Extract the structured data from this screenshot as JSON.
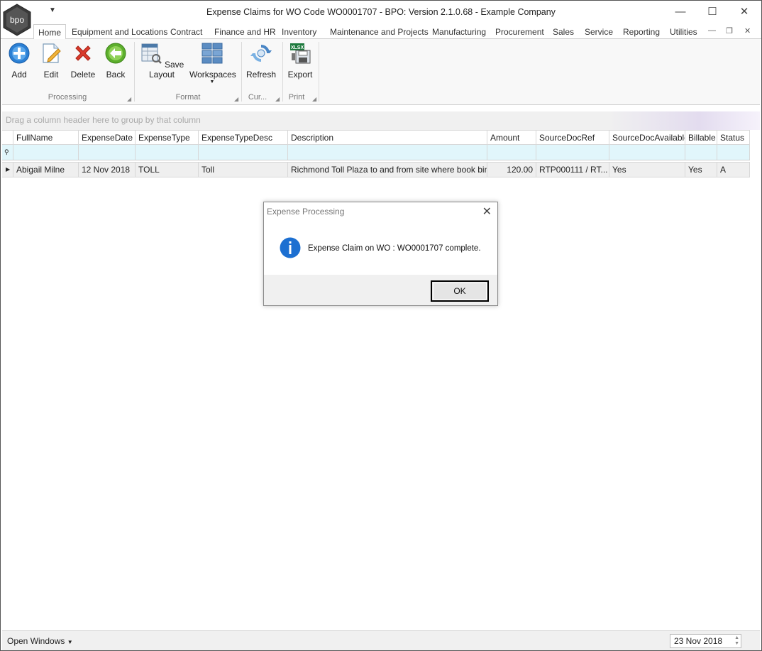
{
  "window": {
    "title": "Expense Claims for WO Code WO0001707 - BPO: Version 2.1.0.68 - Example Company",
    "logo_text": "bpo",
    "minimize_icon": "minimize-icon",
    "maximize_icon": "maximize-icon",
    "close_icon": "close-icon"
  },
  "tabs": [
    {
      "label": "Home",
      "active": true
    },
    {
      "label": "Equipment and Locations"
    },
    {
      "label": "Contract"
    },
    {
      "label": "Finance and HR"
    },
    {
      "label": "Inventory"
    },
    {
      "label": "Maintenance and Projects"
    },
    {
      "label": "Manufacturing"
    },
    {
      "label": "Procurement"
    },
    {
      "label": "Sales"
    },
    {
      "label": "Service"
    },
    {
      "label": "Reporting"
    },
    {
      "label": "Utilities"
    }
  ],
  "ribbon": {
    "add": "Add",
    "edit": "Edit",
    "delete": "Delete",
    "back": "Back",
    "save_layout": "Save Layout",
    "workspaces": "Workspaces",
    "refresh": "Refresh",
    "export": "Export",
    "export_badge": "XLSX",
    "groups": {
      "processing": "Processing",
      "format": "Format",
      "current": "Cur...",
      "print": "Print"
    }
  },
  "grid": {
    "group_panel_hint": "Drag a column header here to group by that column",
    "columns": [
      "FullName",
      "ExpenseDate",
      "ExpenseType",
      "ExpenseTypeDesc",
      "Description",
      "Amount",
      "SourceDocRef",
      "SourceDocAvailable",
      "Billable",
      "Status"
    ],
    "rows": [
      [
        "Abigail Milne",
        "12 Nov 2018",
        "TOLL",
        "Toll",
        "Richmond Toll Plaza to and from site where book bindi...",
        "120.00",
        "RTP000111 / RT...",
        "Yes",
        "Yes",
        "A"
      ]
    ]
  },
  "dialog": {
    "title": "Expense Processing",
    "message": "Expense Claim on WO : WO0001707 complete.",
    "ok": "OK"
  },
  "status": {
    "open_windows": "Open Windows",
    "date": "23 Nov 2018"
  },
  "colors": {
    "filter_row": "#e1f6fb",
    "info_blue": "#1c6fd1",
    "add_blue": "#2a7fd4",
    "delete_red": "#d93a2b",
    "back_green": "#5cae2c"
  }
}
